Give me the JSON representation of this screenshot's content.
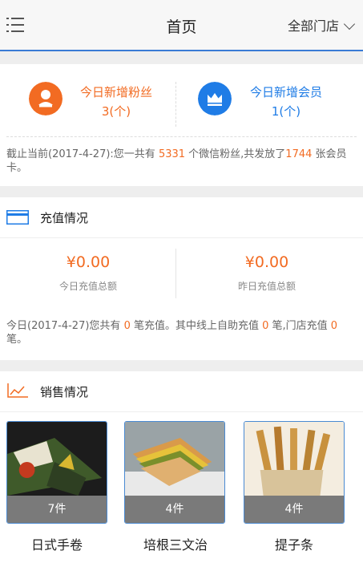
{
  "header": {
    "title": "首页",
    "store_filter": "全部门店"
  },
  "stats": {
    "new_fans_label": "今日新增粉丝",
    "new_fans_value": "3(个)",
    "new_members_label": "今日新增会员",
    "new_members_value": "1(个)",
    "summary": {
      "prefix": "截止当前(2017-4-27):您一共有 ",
      "fans_total": "5331",
      "middle": " 个微信粉丝,共发放了",
      "cards_total": "1744",
      "suffix": " 张会员卡。"
    }
  },
  "recharge": {
    "title": "充值情况",
    "today_amount": "¥0.00",
    "today_label": "今日充值总额",
    "yesterday_amount": "¥0.00",
    "yesterday_label": "昨日充值总额",
    "summary": {
      "prefix": "今日(2017-4-27)您共有 ",
      "count": "0",
      "middle1": " 笔充值。其中线上自助充值 ",
      "online": "0",
      "middle2": " 笔,门店充值 ",
      "store": "0",
      "suffix": " 笔。"
    }
  },
  "sales": {
    "title": "销售情况",
    "products": [
      {
        "name": "日式手卷",
        "count": "7件"
      },
      {
        "name": "培根三文治",
        "count": "4件"
      },
      {
        "name": "提子条",
        "count": "4件"
      }
    ]
  },
  "colors": {
    "accent_orange": "#f26b22",
    "accent_blue": "#1f7ce6",
    "header_line": "#3a7bd5"
  }
}
